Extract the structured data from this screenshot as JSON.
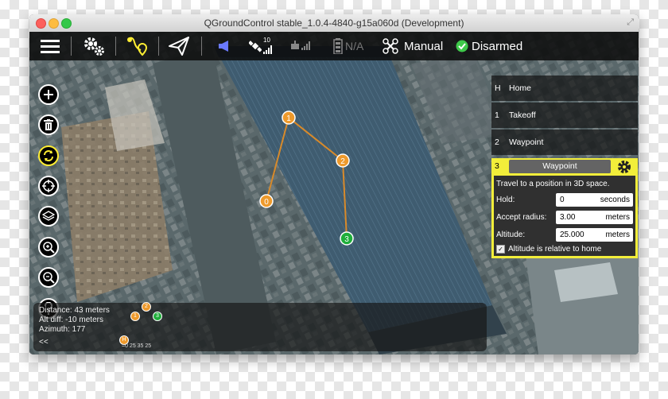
{
  "window": {
    "title": "QGroundControl stable_1.0.4-4840-g15a060d (Development)"
  },
  "toolbar": {
    "menu_icon": "hamburger-menu-icon",
    "setup_icon": "gears-icon",
    "plan_icon": "plan-route-icon",
    "fly_icon": "paper-plane-icon",
    "messages_icon": "megaphone-icon",
    "gps_count": "10",
    "battery_text": "N/A",
    "flight_mode": "Manual",
    "arm_status": "Disarmed"
  },
  "side_tools": [
    {
      "icon": "add-waypoint-icon"
    },
    {
      "icon": "trash-icon"
    },
    {
      "icon": "sync-icon"
    },
    {
      "icon": "center-crosshair-icon"
    },
    {
      "icon": "map-layers-icon"
    },
    {
      "icon": "zoom-in-icon"
    },
    {
      "icon": "zoom-out-icon"
    },
    {
      "icon": "help-icon"
    }
  ],
  "mission_items": [
    {
      "seq": "H",
      "label": "Home"
    },
    {
      "seq": "1",
      "label": "Takeoff"
    },
    {
      "seq": "2",
      "label": "Waypoint"
    }
  ],
  "editor": {
    "seq": "3",
    "command": "Waypoint",
    "description": "Travel to a position in 3D space.",
    "hold_label": "Hold:",
    "hold_value": "0",
    "hold_unit": "seconds",
    "radius_label": "Accept radius:",
    "radius_value": "3.00",
    "radius_unit": "meters",
    "altitude_label": "Altitude:",
    "altitude_value": "25.000",
    "altitude_unit": "meters",
    "relative_label": "Altitude is relative to home",
    "relative_checked": true
  },
  "map_markers": [
    {
      "label": "0",
      "color": "#ee9a2c"
    },
    {
      "label": "1",
      "color": "#ee9a2c"
    },
    {
      "label": "2",
      "color": "#ee9a2c"
    },
    {
      "label": "3",
      "color": "#1fae3a"
    }
  ],
  "info": {
    "distance": "Distance: 43 meters",
    "alt_diff": "Alt diff: -10 meters",
    "azimuth": "Azimuth: 177",
    "back": "<<",
    "mini_labels": [
      "2",
      "1",
      "3",
      "H"
    ],
    "altitudes": "=0 25 35 25"
  },
  "colors": {
    "accent_yellow": "#f2ee3a",
    "waypoint_orange": "#ee9a2c",
    "current_green": "#1fae3a",
    "armed_ok_green": "#3ec94a"
  }
}
